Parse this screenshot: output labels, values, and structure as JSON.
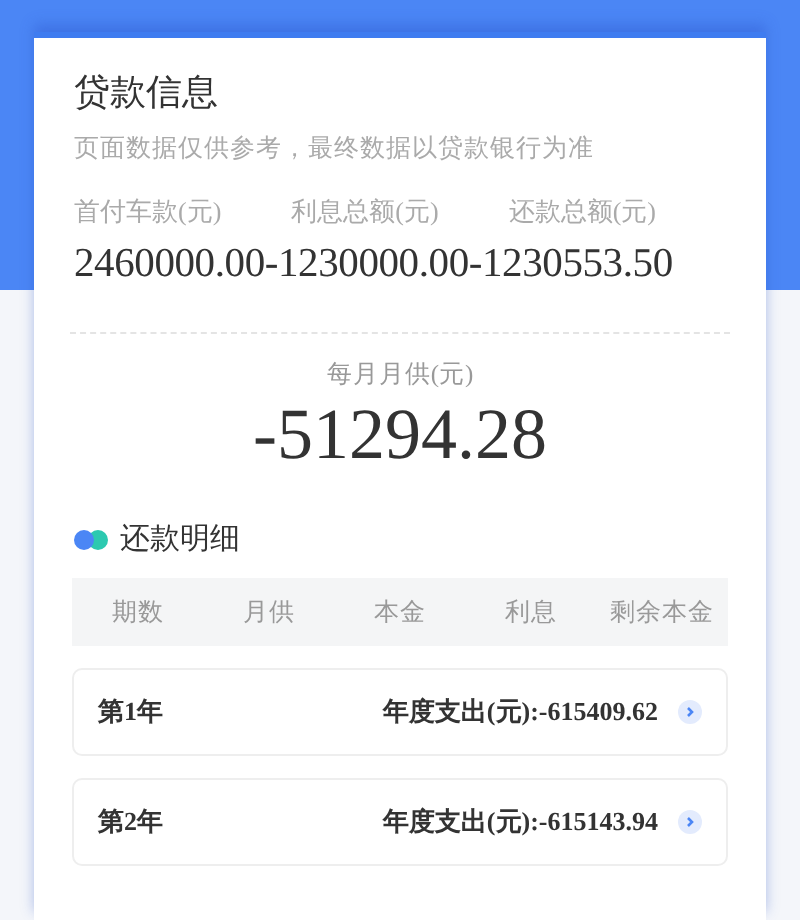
{
  "header": {
    "title": "贷款信息",
    "subtitle": "页面数据仅供参考，最终数据以贷款银行为准"
  },
  "summary": {
    "labels": [
      "首付车款(元)",
      "利息总额(元)",
      "还款总额(元)"
    ],
    "value": "2460000.00-1230000.00-1230553.50"
  },
  "monthly": {
    "label": "每月月供(元)",
    "value": "-51294.28"
  },
  "details": {
    "title": "还款明细",
    "columns": [
      "期数",
      "月供",
      "本金",
      "利息",
      "剩余本金"
    ],
    "rows": [
      {
        "period": "第1年",
        "expense": "年度支出(元):-615409.62"
      },
      {
        "period": "第2年",
        "expense": "年度支出(元):-615143.94"
      }
    ]
  }
}
